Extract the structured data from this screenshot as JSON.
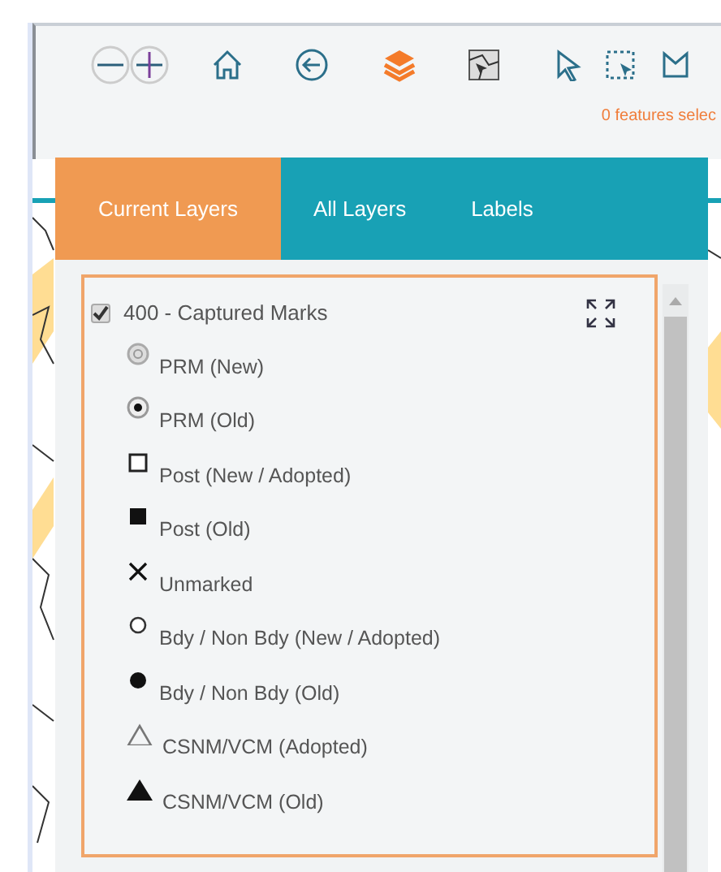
{
  "toolbar": {
    "tools": [
      {
        "kind": "zoom-out",
        "selected": false
      },
      {
        "kind": "zoom-in",
        "selected": false
      },
      {
        "kind": "home",
        "selected": false
      },
      {
        "kind": "back",
        "selected": false
      },
      {
        "kind": "layers",
        "selected": true
      },
      {
        "kind": "map-select",
        "selected": false
      },
      {
        "kind": "pointer",
        "selected": false
      },
      {
        "kind": "rect-select",
        "selected": false
      },
      {
        "kind": "polygon",
        "selected": false
      }
    ],
    "status": "0 features selec"
  },
  "tabs": [
    {
      "label": "Current Layers",
      "selected": true
    },
    {
      "label": "All Layers",
      "selected": false
    },
    {
      "label": "Labels",
      "selected": false
    }
  ],
  "layer": {
    "title": "400 - Captured Marks",
    "checked": true,
    "legend": [
      {
        "kind": "target",
        "label": "PRM (New)"
      },
      {
        "kind": "dot-ring",
        "label": "PRM (Old)"
      },
      {
        "kind": "square-open",
        "label": "Post (New / Adopted)"
      },
      {
        "kind": "square-filled",
        "label": "Post (Old)"
      },
      {
        "kind": "cross",
        "label": "Unmarked"
      },
      {
        "kind": "circle-open",
        "label": "Bdy / Non Bdy (New / Adopted)"
      },
      {
        "kind": "circle-filled",
        "label": "Bdy / Non Bdy (Old)"
      },
      {
        "kind": "triangle-open",
        "label": "CSNM/VCM (Adopted)"
      },
      {
        "kind": "triangle-filled",
        "label": "CSNM/VCM (Old)"
      }
    ]
  }
}
